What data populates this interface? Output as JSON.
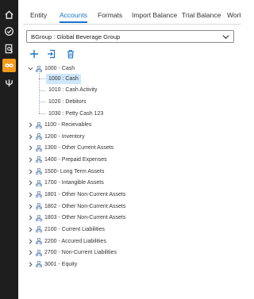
{
  "tabs": [
    {
      "label": "Entity"
    },
    {
      "label": "Accounts"
    },
    {
      "label": "Formats"
    },
    {
      "label": "Import Balance"
    },
    {
      "label": "Trial Balance"
    },
    {
      "label": "Work"
    }
  ],
  "active_tab": "Accounts",
  "group_select": {
    "value": "BGroup : Global Beverage Group"
  },
  "toolbar": {
    "add_icon": "plus-icon",
    "import_icon": "import-file-icon",
    "delete_icon": "trash-icon"
  },
  "colors": {
    "rail": "#1e1e1e",
    "accent": "#f29b1a",
    "link": "#1a73c8",
    "selected_bg": "#cfe6fb"
  },
  "tree": {
    "root": {
      "label": "1000 - Cash",
      "expanded": true
    },
    "children": [
      {
        "label": "1000 : Cash",
        "selected": true
      },
      {
        "label": "1010 : Cash Activity"
      },
      {
        "label": "1020 : Debitors"
      },
      {
        "label": "1030 : Petty Cash 123"
      }
    ],
    "collapsed_items": [
      {
        "label": "1100 - Recievables"
      },
      {
        "label": "1200 - Inventory"
      },
      {
        "label": "1300 - Other Current Assets"
      },
      {
        "label": "1400 - Prepaid Expenses"
      },
      {
        "label": "1500- Long Term Assets"
      },
      {
        "label": "1700 - Intangible Assets"
      },
      {
        "label": "1801 - Other Non-Current Assets"
      },
      {
        "label": "1802 - Other Non-Current Assets"
      },
      {
        "label": "1803 - Other Non-Current Assets"
      },
      {
        "label": "2100 - Current Liabilities"
      },
      {
        "label": "2200 - Accured Liabilities"
      },
      {
        "label": "2700 - Non-Current Liabilities"
      },
      {
        "label": "3001 - Equity"
      }
    ]
  }
}
